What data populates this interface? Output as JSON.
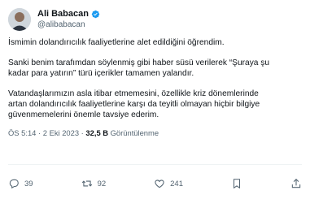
{
  "user": {
    "name": "Ali Babacan",
    "handle": "@alibabacan",
    "verified_icon": "verified-badge-icon",
    "verified_color": "#1d9bf0"
  },
  "tweet": {
    "paragraphs": [
      "İsmimin dolandırıcılık faaliyetlerine alet edildiğini öğrendim.",
      "Sanki benim tarafımdan söylenmiş gibi haber süsü verilerek “Şuraya şu\nkadar para yatırın” türü içerikler tamamen yalandır.",
      "Vatandaşlarımızın asla itibar etmemesini, özellikle kriz dönemlerinde\nartan dolandırıcılık faaliyetlerine karşı da teyitli olmayan hiçbir bilgiye\ngüvenmemelerini önemle tavsiye ederim."
    ],
    "time": "ÖS 5:14",
    "separator": "·",
    "date": "2 Eki 2023",
    "views_count": "32,5 B",
    "views_label": "Görüntülenme"
  },
  "actions": {
    "replies": "39",
    "retweets": "92",
    "likes": "241",
    "icons": [
      "reply-icon",
      "retweet-icon",
      "like-icon",
      "bookmark-icon",
      "share-icon"
    ]
  }
}
